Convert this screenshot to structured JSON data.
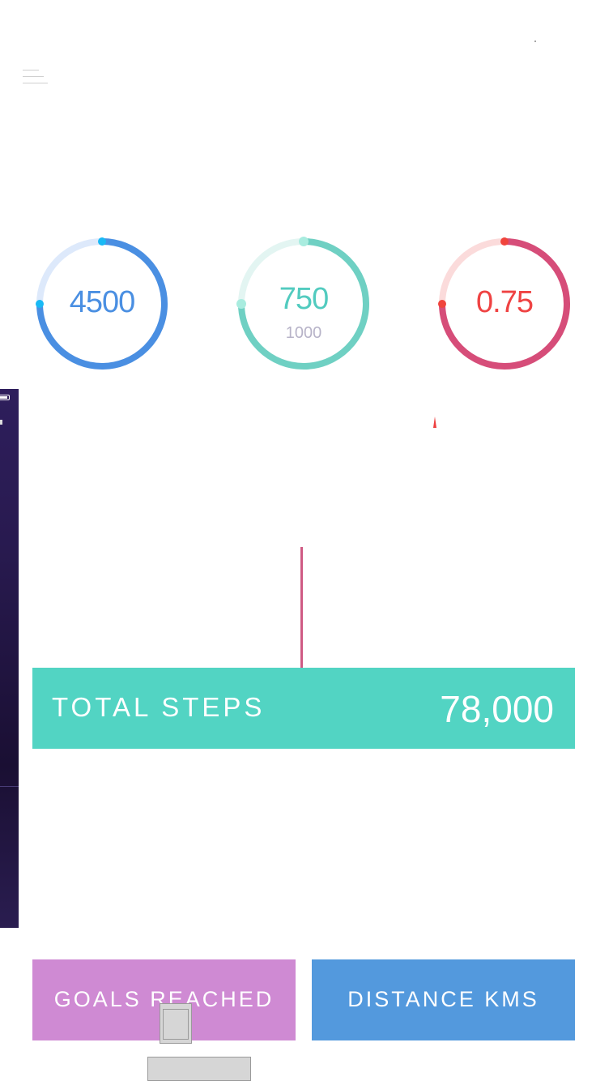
{
  "header": {
    "menu_icon": "hamburger-menu-icon"
  },
  "rings": [
    {
      "value": "4500",
      "sub": "",
      "progress": 0.75,
      "track_color": "#dde9fb",
      "arc_color": "#4a8fe2",
      "knob_color": "#19b9f5",
      "text_color": "#4a8fe2"
    },
    {
      "value": "750",
      "sub": "1000",
      "progress": 0.75,
      "track_color": "#e3f5f2",
      "arc_color": "#6fd0c3",
      "knob_color": "#a9ecdf",
      "text_color": "#52cbbf"
    },
    {
      "value": "0.75",
      "sub": "",
      "progress": 0.75,
      "track_color": "#fbdbdb",
      "arc_color": "#d64d79",
      "knob_color": "#f0443c",
      "text_color": "#ef4343"
    }
  ],
  "total_steps": {
    "label": "TOTAL STEPS",
    "value": "78,000",
    "color": "#52d4c3"
  },
  "tiles": [
    {
      "label": "GOALS REACHED",
      "color": "#cf8ad3"
    },
    {
      "label": "DISTANCE KMS",
      "color": "#5399dd"
    }
  ]
}
